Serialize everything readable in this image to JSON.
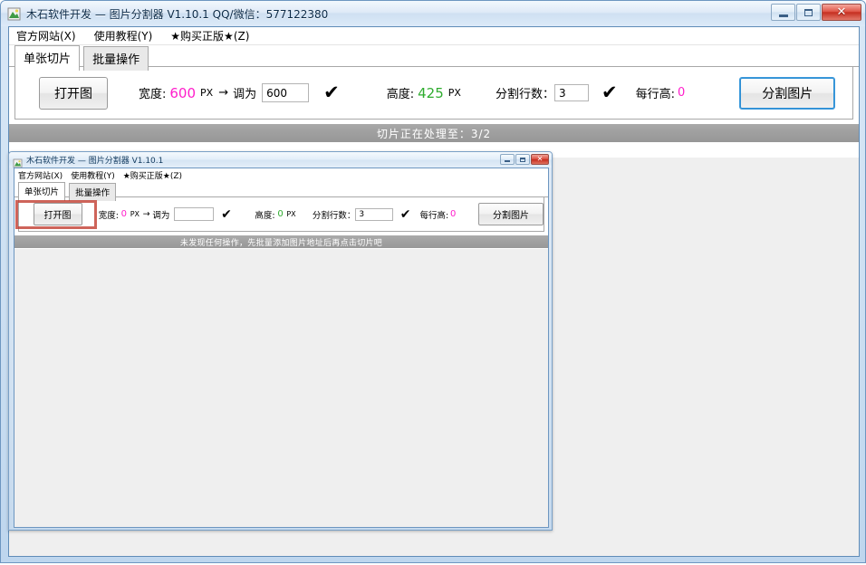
{
  "outer_window": {
    "title": "木石软件开发 — 图片分割器 V1.10.1    QQ/微信：577122380",
    "icon": "app-icon",
    "controls": {
      "minimize": "—",
      "restore": "□",
      "close": "✕"
    },
    "menu": [
      {
        "label": "官方网站(X)"
      },
      {
        "label": "使用教程(Y)"
      },
      {
        "label": "★购买正版★(Z)"
      }
    ],
    "tabs": [
      {
        "label": "单张切片",
        "active": true
      },
      {
        "label": "批量操作",
        "active": false
      }
    ],
    "toolbar": {
      "open_button": "打开图",
      "width_label": "宽度:",
      "width_value": "600",
      "width_unit": "PX",
      "arrow": "→",
      "resize_label": "调为",
      "resize_input_value": "600",
      "resize_input_placeholder": "",
      "check1": "✔",
      "height_label": "高度:",
      "height_value": "425",
      "height_unit": "PX",
      "rows_label": "分割行数：",
      "rows_value": "3",
      "check2": "✔",
      "rowheight_label": "每行高:",
      "rowheight_value": "0",
      "split_button": "分割图片"
    },
    "statusbar": "切片正在处理至：3/2"
  },
  "inner_window": {
    "title": "木石软件开发 — 图片分割器 V1.10.1",
    "icon": "app-icon",
    "controls": {
      "minimize": "—",
      "restore": "□",
      "close": "✕"
    },
    "menu": [
      {
        "label": "官方网站(X)"
      },
      {
        "label": "使用教程(Y)"
      },
      {
        "label": "★购买正版★(Z)"
      }
    ],
    "tabs": [
      {
        "label": "单张切片",
        "active": true
      },
      {
        "label": "批量操作",
        "active": false
      }
    ],
    "toolbar": {
      "open_button": "打开图",
      "width_label": "宽度:",
      "width_value": "0",
      "width_unit": "PX",
      "arrow": "→",
      "resize_label": "调为",
      "resize_input_value": "",
      "resize_input_placeholder": "",
      "check1": "✔",
      "height_label": "高度:",
      "height_value": "0",
      "height_unit": "PX",
      "rows_label": "分割行数：",
      "rows_value": "3",
      "check2": "✔",
      "rowheight_label": "每行高:",
      "rowheight_value": "0",
      "split_button": "分割图片"
    },
    "statusbar": "未发现任何操作，先批量添加图片地址后再点击切片吧"
  },
  "colors": {
    "magenta": "#ff1ecb",
    "green": "#2fac2f",
    "annotation_red": "#c0392b",
    "titlebar_text": "#0b2a47",
    "statusbar_bg": "#a0a0a0"
  }
}
